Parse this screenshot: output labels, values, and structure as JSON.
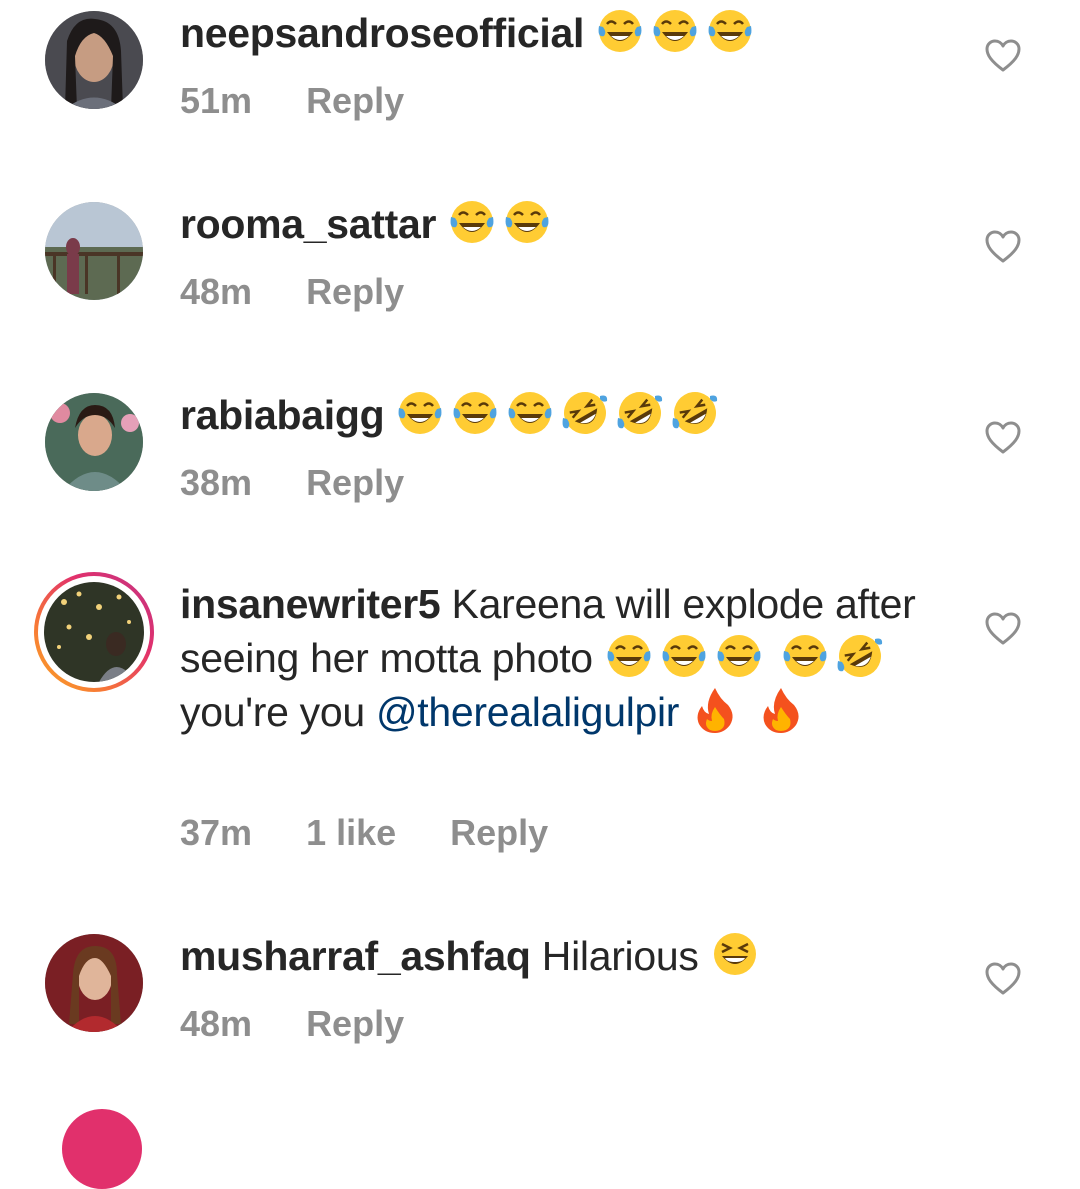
{
  "comments": [
    {
      "username": "neepsandroseofficial",
      "text": "",
      "emojis": [
        "tears-of-joy",
        "tears-of-joy",
        "tears-of-joy"
      ],
      "time": "51m",
      "likes": "",
      "reply": "Reply",
      "has_story": false
    },
    {
      "username": "rooma_sattar",
      "text": "",
      "emojis": [
        "tears-of-joy",
        "tears-of-joy"
      ],
      "time": "48m",
      "likes": "",
      "reply": "Reply",
      "has_story": false
    },
    {
      "username": "rabiabaigg",
      "text": "",
      "emojis": [
        "tears-of-joy",
        "tears-of-joy",
        "tears-of-joy",
        "rofl",
        "rofl",
        "rofl"
      ],
      "time": "38m",
      "likes": "",
      "reply": "Reply",
      "has_story": false
    },
    {
      "username": "insanewriter5",
      "text_part1": "Kareena will explode after seeing her motta photo",
      "text_part2": "you're you",
      "mention": "@therealaligulpir",
      "time": "37m",
      "likes": "1 like",
      "reply": "Reply",
      "has_story": true
    },
    {
      "username": "musharraf_ashfaq",
      "text": "Hilarious",
      "emojis": [
        "grinning-squinting"
      ],
      "time": "48m",
      "likes": "",
      "reply": "Reply",
      "has_story": false
    }
  ],
  "icons": {
    "like": "heart-outline-icon",
    "emoji_tears": "face-with-tears-of-joy",
    "emoji_rofl": "rolling-on-floor-laughing",
    "emoji_fire": "fire",
    "emoji_squint": "grinning-squinting-face"
  },
  "colors": {
    "text": "#262626",
    "meta": "#8e8e8e",
    "mention": "#00376b",
    "emoji_yellow": "#ffcc33"
  }
}
